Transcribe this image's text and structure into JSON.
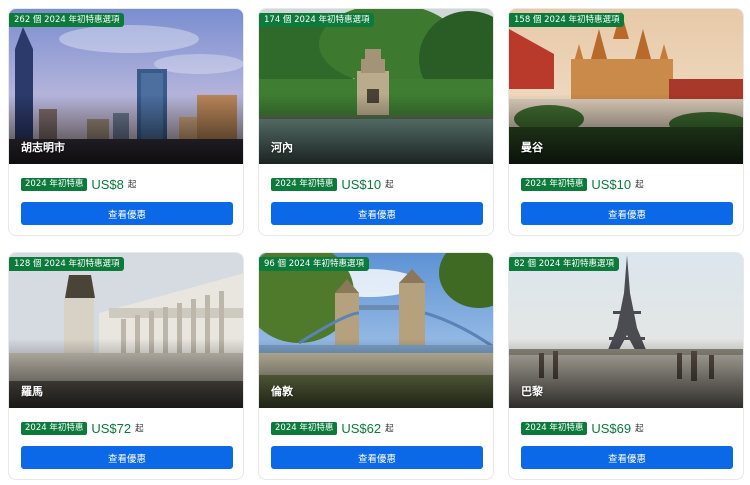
{
  "cta_label": "查看優惠",
  "price_tag_label": "2024 年初特惠",
  "price_suffix": "起",
  "colors": {
    "accent_green": "#0b7a3b",
    "button_blue": "#0b68e6"
  },
  "deals": [
    {
      "badge": "262 個 2024 年初特惠選項",
      "city": "胡志明市",
      "price": "US$8"
    },
    {
      "badge": "174 個 2024 年初特惠選項",
      "city": "河內",
      "price": "US$10"
    },
    {
      "badge": "158 個 2024 年初特惠選項",
      "city": "曼谷",
      "price": "US$10"
    },
    {
      "badge": "128 個 2024 年初特惠選項",
      "city": "羅馬",
      "price": "US$72"
    },
    {
      "badge": "96 個 2024 年初特惠選項",
      "city": "倫敦",
      "price": "US$62"
    },
    {
      "badge": "82 個 2024 年初特惠選項",
      "city": "巴黎",
      "price": "US$69"
    }
  ]
}
